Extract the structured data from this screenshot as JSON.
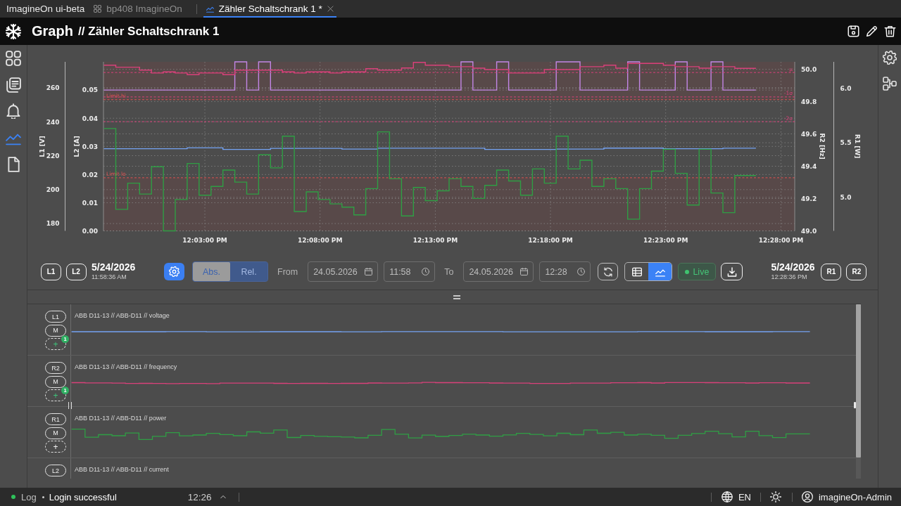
{
  "app_bar": {
    "app_name": "ImagineOn",
    "environment": "ui-beta",
    "tabs": [
      {
        "label": "bp408 ImagineOn",
        "selected": false,
        "closable": false
      },
      {
        "label": "Zähler Schaltschrank 1 *",
        "selected": true,
        "closable": true
      }
    ]
  },
  "header": {
    "section": "Graph",
    "separator": "//",
    "title": "Zähler Schaltschrank 1"
  },
  "sidebar": {
    "items": [
      {
        "selected": false
      },
      {
        "selected": false
      },
      {
        "selected": false
      },
      {
        "selected": true
      },
      {
        "selected": false
      }
    ]
  },
  "chart": {
    "left_axes": {
      "chart_data": {
        "type": "line",
        "grid": true,
        "x": [
          43117,
          43334,
          43334,
          43427,
          43427,
          43458,
          43458,
          43489,
          43489,
          43520,
          43520,
          43551,
          43551,
          43737,
          43737,
          43830,
          43830,
          44047,
          44047,
          44078,
          44078,
          44109,
          44109,
          44140,
          44140,
          44171,
          44171,
          44295,
          44295,
          44357,
          44357,
          44419,
          44419,
          44481,
          44481,
          44512,
          44512,
          44574,
          44574,
          44605,
          44605,
          44636,
          44636,
          44698,
          44698,
          44729,
          44729,
          44815
        ],
        "xlim": [
          43116,
          44916
        ],
        "xticks": [
          {
            "value": 43380,
            "label": "12:03:00 PM"
          },
          {
            "value": 43680,
            "label": "12:08:00 PM"
          },
          {
            "value": 43980,
            "label": "12:13:00 PM"
          },
          {
            "value": 44280,
            "label": "12:18:00 PM"
          },
          {
            "value": 44580,
            "label": "12:23:00 PM"
          },
          {
            "value": 44880,
            "label": "12:28:00 PM"
          }
        ],
        "ylabel": "L1 [V]",
        "ylim": [
          175.7,
          275.3
        ],
        "yticks": [
          180,
          200,
          220,
          240,
          260
        ],
        "y2label": "L2 [A]",
        "y2lim": [
          0,
          0.06
        ],
        "y2ticks": [
          {
            "value": 0,
            "label": "0.00"
          },
          {
            "value": 0.01,
            "label": "0.01"
          },
          {
            "value": 0.02,
            "label": "0.02"
          },
          {
            "value": 0.03,
            "label": "0.03"
          },
          {
            "value": 0.04,
            "label": "0.04"
          },
          {
            "value": 0.05,
            "label": "0.05"
          }
        ],
        "series": [
          {
            "color": "#74a2f2",
            "values": [
              224.1,
              224.1,
              224.6,
              224.6,
              223.7,
              223.7,
              223.7,
              223.7,
              223.7,
              223.7,
              223.7,
              223.7,
              224.3,
              224.3,
              223.9,
              223.9,
              224.4,
              224.4,
              224.4,
              224.4,
              224.4,
              224.4,
              223.7,
              223.7,
              223.7,
              223.7,
              223.7,
              223.7,
              223.9,
              223.9,
              223.9,
              223.9,
              224.5,
              224.5,
              224.5,
              224.5,
              224.5,
              224.5,
              224.1,
              224.1,
              224.1,
              224.1,
              224.1,
              224.1,
              224.1,
              224.1,
              224.4,
              224.4
            ]
          },
          {
            "axis": "y2",
            "color": "#c285e6",
            "values": [
              0.05,
              0.05,
              0.05,
              0.05,
              0.05,
              0.05,
              0.06,
              0.06,
              0.05,
              0.05,
              0.06,
              0.06,
              0.05,
              0.05,
              0.05,
              0.05,
              0.05,
              0.05,
              0.06,
              0.06,
              0.05,
              0.05,
              0.05,
              0.05,
              0.06,
              0.06,
              0.05,
              0.05,
              0.06,
              0.06,
              0.05,
              0.05,
              0.05,
              0.05,
              0.06,
              0.06,
              0.05,
              0.05,
              0.05,
              0.05,
              0.06,
              0.06,
              0.05,
              0.05,
              0.06,
              0.06,
              0.05,
              0.05
            ]
          }
        ],
        "ref_lines": [
          {
            "axis": "y",
            "value": 253,
            "label": "Limit hi",
            "color": "#e05252"
          },
          {
            "axis": "y",
            "value": 207,
            "label": "Limit lo",
            "color": "#e05252"
          }
        ],
        "bands": [
          {
            "axis": "y",
            "from": 253,
            "to": 275.3
          },
          {
            "axis": "y",
            "from": 175.7,
            "to": 207
          }
        ]
      }
    },
    "right_axes": {
      "chart_data": {
        "type": "line",
        "grid": true,
        "x": [
          43117,
          43148,
          43148,
          43179,
          43179,
          43210,
          43210,
          43241,
          43241,
          43272,
          43272,
          43303,
          43303,
          43334,
          43334,
          43365,
          43365,
          43396,
          43396,
          43427,
          43427,
          43458,
          43458,
          43489,
          43489,
          43520,
          43520,
          43551,
          43551,
          43582,
          43582,
          43613,
          43613,
          43644,
          43644,
          43675,
          43675,
          43706,
          43706,
          43737,
          43737,
          43768,
          43768,
          43799,
          43799,
          43830,
          43830,
          43861,
          43861,
          43892,
          43892,
          43923,
          43923,
          43954,
          43954,
          43985,
          43985,
          44016,
          44016,
          44047,
          44047,
          44078,
          44078,
          44109,
          44109,
          44140,
          44140,
          44171,
          44171,
          44202,
          44202,
          44233,
          44233,
          44264,
          44264,
          44295,
          44295,
          44326,
          44326,
          44357,
          44357,
          44388,
          44388,
          44419,
          44419,
          44450,
          44450,
          44481,
          44481,
          44512,
          44512,
          44543,
          44543,
          44574,
          44574,
          44605,
          44605,
          44636,
          44636,
          44667,
          44667,
          44698,
          44698,
          44729,
          44729,
          44760,
          44760,
          44815
        ],
        "xlim": [
          43116,
          44916
        ],
        "ylabel": "R2 [Hz]",
        "ylim": [
          49.0,
          50.046
        ],
        "yticks": [
          {
            "value": 49.0,
            "label": "49.0"
          },
          {
            "value": 49.2,
            "label": "49.2"
          },
          {
            "value": 49.4,
            "label": "49.4"
          },
          {
            "value": 49.6,
            "label": "49.6"
          },
          {
            "value": 49.8,
            "label": "49.8"
          },
          {
            "value": 50.0,
            "label": "50.0"
          }
        ],
        "y2label": "R1 [W]",
        "y2lim": [
          4.693,
          6.241
        ],
        "y2ticks": [
          {
            "value": 5.0,
            "label": "5.0"
          },
          {
            "value": 5.5,
            "label": "5.5"
          },
          {
            "value": 6.0,
            "label": "6.0"
          }
        ],
        "series": [
          {
            "color": "#d9407a",
            "values": [
              50.025,
              50.025,
              50.013,
              50.013,
              50.013,
              50.013,
              49.995,
              49.995,
              49.977,
              49.977,
              49.984,
              49.984,
              49.977,
              49.977,
              49.967,
              49.967,
              49.977,
              49.977,
              49.977,
              49.977,
              49.967,
              49.967,
              49.995,
              49.995,
              49.995,
              49.995,
              49.995,
              49.995,
              49.995,
              49.995,
              49.984,
              49.984,
              49.977,
              49.977,
              49.984,
              49.984,
              49.984,
              49.984,
              49.977,
              49.977,
              49.984,
              49.984,
              49.984,
              49.984,
              50.004,
              50.004,
              49.995,
              49.995,
              49.995,
              49.995,
              50.008,
              50.008,
              50.043,
              50.043,
              50.025,
              50.025,
              50.025,
              50.025,
              50.016,
              50.016,
              50.016,
              50.016,
              50.007,
              50.007,
              49.998,
              49.998,
              49.998,
              49.998,
              49.977,
              49.977,
              49.977,
              49.977,
              49.977,
              49.977,
              49.998,
              49.998,
              49.998,
              49.998,
              49.998,
              49.998,
              50.016,
              50.016,
              50.016,
              50.016,
              50.025,
              50.025,
              50.007,
              50.007,
              50.036,
              50.036,
              50.036,
              50.036,
              50.036,
              50.036,
              50.025,
              50.025,
              50.016,
              50.016,
              50.016,
              50.016,
              50.007,
              50.007,
              50.016,
              50.016,
              50.016,
              50.016,
              50.006,
              50.006
            ]
          },
          {
            "axis": "y2",
            "color": "#2f9e44",
            "values": [
              5.63,
              5.63,
              4.89,
              4.89,
              5.13,
              5.13,
              5.03,
              5.03,
              5.28,
              5.28,
              4.693,
              4.693,
              4.98,
              4.98,
              5.31,
              5.31,
              5.02,
              5.02,
              5.1,
              5.1,
              5.25,
              5.25,
              5.14,
              5.14,
              5.03,
              5.03,
              5.39,
              5.39,
              5.27,
              5.27,
              5.56,
              5.56,
              4.87,
              4.87,
              5.05,
              5.05,
              4.98,
              4.98,
              4.94,
              4.94,
              4.91,
              4.91,
              4.84,
              4.84,
              5.08,
              5.08,
              5.6,
              5.6,
              5.17,
              5.17,
              4.83,
              4.83,
              5.09,
              5.09,
              4.97,
              4.97,
              5.06,
              5.06,
              5.17,
              5.17,
              5.1,
              5.1,
              4.99,
              4.99,
              5.11,
              5.11,
              5.25,
              5.25,
              5.15,
              5.15,
              5.02,
              5.02,
              5.26,
              5.26,
              5.13,
              5.13,
              5.56,
              5.56,
              5.26,
              5.26,
              5.34,
              5.34,
              5.1,
              5.1,
              5.17,
              5.17,
              5.08,
              5.08,
              4.8,
              4.8,
              5.08,
              5.08,
              5.24,
              5.24,
              5.44,
              5.44,
              5.22,
              5.22,
              4.93,
              4.93,
              5.44,
              5.44,
              5.04,
              5.04,
              4.86,
              4.86,
              5.2,
              5.2
            ]
          }
        ],
        "ref_lines": [
          {
            "axis": "y",
            "value": 49.98,
            "label": "μ",
            "color": "#d9407a"
          },
          {
            "axis": "y",
            "value": 49.829,
            "label": "-1σ",
            "color": "#d9407a"
          },
          {
            "axis": "y",
            "value": 49.676,
            "label": "-2σ",
            "color": "#d9407a"
          }
        ]
      }
    }
  },
  "controls": {
    "left_axis_buttons": [
      "L1",
      "L2"
    ],
    "range_start": {
      "date": "5/24/2026",
      "time": "11:58:36 AM"
    },
    "mode_options": [
      {
        "label": "Abs.",
        "selected": true
      },
      {
        "label": "Rel.",
        "selected": false
      }
    ],
    "from": {
      "label": "From",
      "date": "24.05.2026",
      "time": "11:58"
    },
    "to": {
      "label": "To",
      "date": "24.05.2026",
      "time": "12:28"
    },
    "view_options": [
      {
        "selected": false
      },
      {
        "selected": true
      }
    ],
    "live": {
      "label": "Live"
    },
    "range_end": {
      "date": "5/24/2026",
      "time": "12:28:36 PM"
    },
    "right_axis_buttons": [
      "R1",
      "R2"
    ]
  },
  "series_panel": {
    "rows": [
      {
        "axis_button": "L1",
        "mode_button": "M",
        "add_button": {
          "label": "+",
          "badge": "1"
        },
        "title": "ABB D11-13 // ABB-D11 // voltage"
      },
      {
        "axis_button": "R2",
        "mode_button": "M",
        "add_button": {
          "label": "+",
          "badge": "1"
        },
        "title": "ABB D11-13 // ABB-D11 // frequency"
      },
      {
        "axis_button": "R1",
        "mode_button": "M",
        "add_button": {
          "label": "+"
        },
        "title": "ABB D11-13 // ABB-D11 // power"
      },
      {
        "axis_button": "L2",
        "title": "ABB D11-13 // ABB-D11 // current"
      }
    ]
  },
  "status_bar": {
    "log_label": "Log",
    "message": "Login successful",
    "time": "12:26",
    "language": "EN",
    "user": "imagineOn-Admin"
  }
}
